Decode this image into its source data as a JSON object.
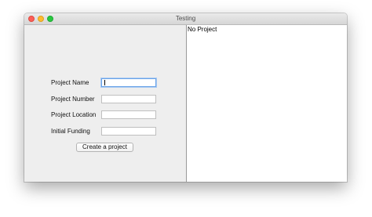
{
  "window": {
    "title": "Testing",
    "controls": {
      "close_color": "#fc5f57",
      "minimize_color": "#fdbc2e",
      "maximize_color": "#28c840"
    }
  },
  "form": {
    "fields": [
      {
        "label": "Project Name",
        "value": "",
        "focused": true
      },
      {
        "label": "Project Number",
        "value": ""
      },
      {
        "label": "Project Location",
        "value": ""
      },
      {
        "label": "Initial Funding",
        "value": ""
      }
    ],
    "create_label": "Create a project"
  },
  "output": {
    "text": "No Project"
  }
}
